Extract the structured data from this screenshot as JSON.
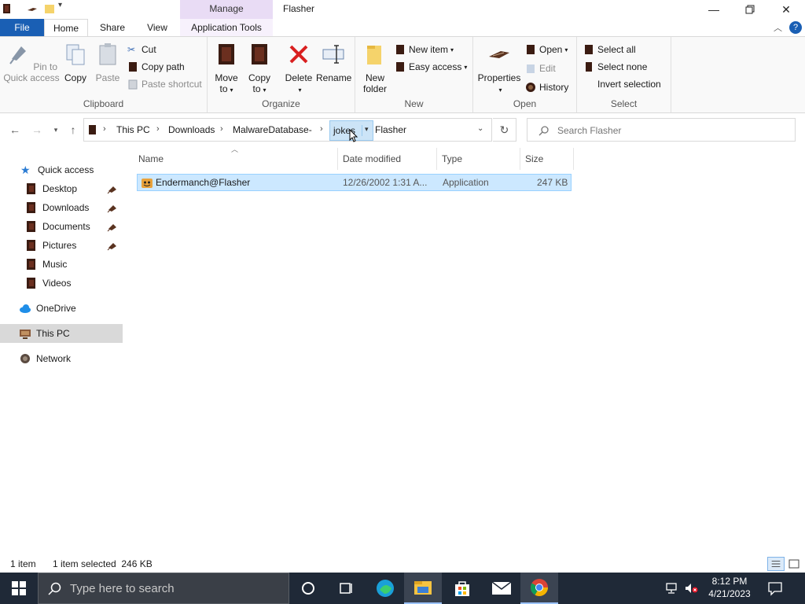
{
  "window": {
    "title": "Flasher",
    "context_tab": "Manage"
  },
  "ribbon_tabs": [
    "File",
    "Home",
    "Share",
    "View",
    "Application Tools"
  ],
  "ribbon": {
    "clipboard": {
      "label": "Clipboard",
      "pin": "Pin to Quick access",
      "copy": "Copy",
      "paste": "Paste",
      "cut": "Cut",
      "copy_path": "Copy path",
      "paste_shortcut": "Paste shortcut"
    },
    "organize": {
      "label": "Organize",
      "move_to": "Move to",
      "copy_to": "Copy to",
      "delete": "Delete",
      "rename": "Rename"
    },
    "new": {
      "label": "New",
      "new_folder": "New folder",
      "new_item": "New item",
      "easy_access": "Easy access"
    },
    "open": {
      "label": "Open",
      "properties": "Properties",
      "open": "Open",
      "edit": "Edit",
      "history": "History"
    },
    "select": {
      "label": "Select",
      "select_all": "Select all",
      "select_none": "Select none",
      "invert": "Invert selection"
    }
  },
  "address": {
    "crumbs": [
      "This PC",
      "Downloads",
      "MalwareDatabase-",
      "jokes",
      "Flasher"
    ]
  },
  "search": {
    "placeholder": "Search Flasher"
  },
  "nav": {
    "quick_access": "Quick access",
    "items": [
      "Desktop",
      "Downloads",
      "Documents",
      "Pictures",
      "Music",
      "Videos"
    ],
    "onedrive": "OneDrive",
    "this_pc": "This PC",
    "network": "Network"
  },
  "columns": [
    "Name",
    "Date modified",
    "Type",
    "Size"
  ],
  "files": [
    {
      "name": "Endermanch@Flasher",
      "date": "12/26/2002 1:31 A...",
      "type": "Application",
      "size": "247 KB"
    }
  ],
  "status": {
    "count": "1 item",
    "selected": "1 item selected  246 KB"
  },
  "taskbar": {
    "search_placeholder": "Type here to search",
    "time": "8:12 PM",
    "date": "4/21/2023"
  },
  "colors": {
    "file_tab": "#1a5fb4",
    "manage_tab": "#e9dcf5",
    "selection": "#cce8ff",
    "taskbar": "#1f2937"
  }
}
